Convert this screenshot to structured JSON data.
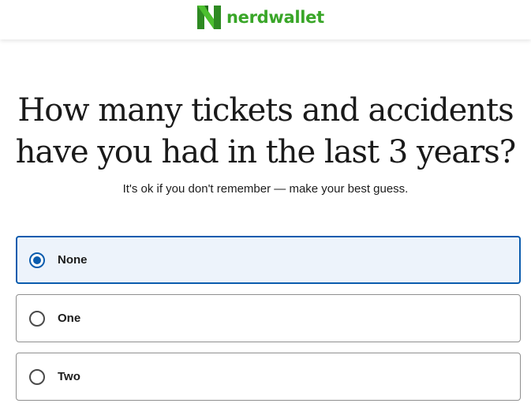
{
  "header": {
    "brand_name": "nerdwallet",
    "brand_color": "#39a628",
    "logo_icon": "nerdwallet-n-logo-icon"
  },
  "question": {
    "title_line1": "How many tickets and accidents",
    "title_line2": "have you had in the last 3 years?",
    "subtitle": "It's ok if you don't remember — make your best guess."
  },
  "options": [
    {
      "label": "None",
      "selected": true
    },
    {
      "label": "One",
      "selected": false
    },
    {
      "label": "Two",
      "selected": false
    }
  ],
  "colors": {
    "selected_border": "#0b5cae",
    "selected_background": "#edf3fb",
    "option_border": "#8f8f8f"
  }
}
